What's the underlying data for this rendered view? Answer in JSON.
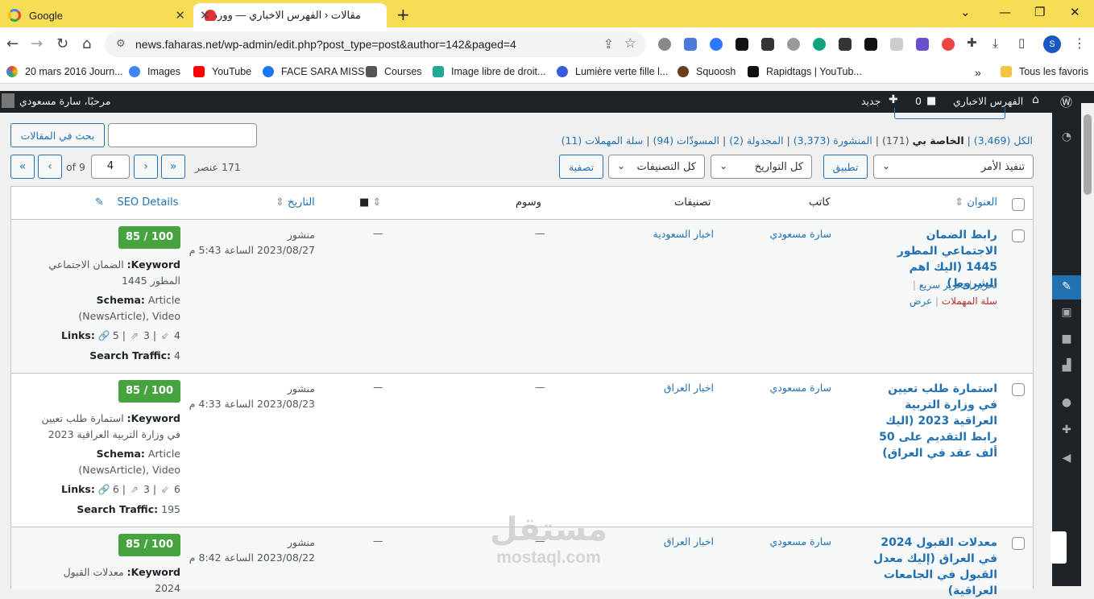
{
  "browser": {
    "tabs": [
      {
        "title": "Google"
      },
      {
        "title": "مقالات ‹ الفهرس الاخباري — ووردبريس"
      }
    ],
    "url": "news.faharas.net/wp-admin/edit.php?post_type=post&author=142&paged=4",
    "profile_initial": "S",
    "bookmarks": [
      {
        "label": "20 mars 2016 Journ...",
        "color": "#ea4335"
      },
      {
        "label": "Images",
        "color": "#4285f4"
      },
      {
        "label": "YouTube",
        "color": "#ff0000"
      },
      {
        "label": "FACE SARA MISS",
        "color": "#1877f2"
      },
      {
        "label": "Courses",
        "color": "#555555"
      },
      {
        "label": "Image libre de droit...",
        "color": "#22a699"
      },
      {
        "label": "Lumière verte fille l...",
        "color": "#3b5bdb"
      },
      {
        "label": "Squoosh",
        "color": "#6b3b1f"
      },
      {
        "label": "Rapidtags | YouTub...",
        "color": "#111111"
      }
    ],
    "bookmarks_more": "»",
    "all_bookmarks": "Tous les favoris"
  },
  "adminbar": {
    "site_name": "الفهرس الاخباري",
    "comments_count": "0",
    "new_label": "جديد",
    "greeting": "مرحبًا، سارة مسعودي"
  },
  "subsubsub": {
    "all": "الكل (3,469)",
    "mine": "الخاصة بي",
    "mine_count": "(171)",
    "published": "المنشورة (3,373)",
    "scheduled": "المجدولة (2)",
    "drafts": "المسودّات (94)",
    "trash": "سلة المهملات (11)"
  },
  "search": {
    "button": "بحث في المقالات",
    "value": ""
  },
  "filters": {
    "bulk_action": "تنفيذ الأمر",
    "apply": "تطبيق",
    "dates": "كل التواريخ",
    "categories": "كل التصنيفات",
    "filter": "تصفية"
  },
  "pagination": {
    "items": "171 عنصر",
    "current": "4",
    "of": "of",
    "total_pages": "9",
    "first": "«",
    "prev": "‹",
    "next": "›",
    "last": "»"
  },
  "columns": {
    "title": "العنوان",
    "author": "كاتب",
    "categories": "تصنيفات",
    "tags": "وسوم",
    "date": "التاريخ",
    "seo": "SEO Details"
  },
  "row_actions": {
    "edit": "تحرير",
    "quick_edit": "تحرير سريع",
    "trash": "سلة المهملات",
    "view": "عرض"
  },
  "seo_labels": {
    "keyword": "Keyword:",
    "schema": "Schema:",
    "links": "Links:",
    "traffic": "Search Traffic:"
  },
  "posts": [
    {
      "title": "رابط الضمان الاجتماعي المطور 1445 (اليك اهم الشروط)",
      "author": "سارة مسعودي",
      "category": "اخبار السعودية",
      "tags": "—",
      "comments": "—",
      "status": "منشور",
      "date": "2023/08/27 الساعة 5:43 م",
      "score": "85 / 100",
      "keyword": "الضمان الاجتماعي المطور 1445",
      "schema": "Article (NewsArticle), Video",
      "links_internal": "5",
      "links_external": "3",
      "links_incoming": "4",
      "traffic": "4"
    },
    {
      "title": "استمارة طلب تعيين في وزارة التربية العراقية 2023 (اليك رابط التقديم على 50 ألف عقد في العراق)",
      "author": "سارة مسعودي",
      "category": "اخبار العراق",
      "tags": "—",
      "comments": "—",
      "status": "منشور",
      "date": "2023/08/23 الساعة 4:33 م",
      "score": "85 / 100",
      "keyword": "استمارة طلب تعيين في وزارة التربية العراقية 2023",
      "schema": "Article (NewsArticle), Video",
      "links_internal": "6",
      "links_external": "3",
      "links_incoming": "6",
      "traffic": "195"
    },
    {
      "title": "معدلات القبول 2024 في العراق (إليك معدل القبول في الجامعات العراقية)",
      "author": "سارة مسعودي",
      "category": "اخبار العراق",
      "tags": "—",
      "comments": "—",
      "status": "منشور",
      "date": "2023/08/22 الساعة 8:42 م",
      "score": "85 / 100",
      "keyword": "معدلات القبول 2024"
    }
  ],
  "watermark": {
    "arabic": "مستقل",
    "latin": "mostaql.com"
  }
}
